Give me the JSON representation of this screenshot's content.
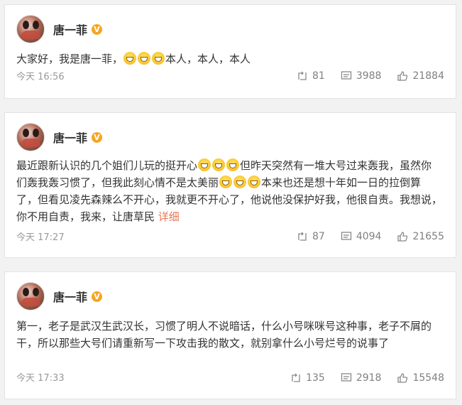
{
  "posts": [
    {
      "author": "唐一菲",
      "verified_mark": "V",
      "text_parts": [
        "大家好，我是唐一菲，",
        "本人，本人，本人"
      ],
      "emoji_icons": [
        "smile-face-icon",
        "laugh-cry-icon",
        "laugh-cry-icon"
      ],
      "time": "今天 16:56",
      "repost_count": "81",
      "comment_count": "3988",
      "like_count": "21884"
    },
    {
      "author": "唐一菲",
      "verified_mark": "V",
      "text_parts": [
        "最近跟新认识的几个姐们儿玩的挺开心",
        "但昨天突然有一堆大号过来轰我，虽然你们轰我轰习惯了，但我此刻心情不是太美丽",
        "本来也还是想十年如一日的拉倒算了，但看见凌先森辣么不开心，我就更不开心了，他说他没保护好我，他很自责。我想说，你不用自责，我来，让唐草民 "
      ],
      "more_label": "详细",
      "emoji_icons": [
        "grin-icon"
      ],
      "time": "今天 17:27",
      "repost_count": "87",
      "comment_count": "4094",
      "like_count": "21655"
    },
    {
      "author": "唐一菲",
      "verified_mark": "V",
      "text_parts": [
        "第一，老子是武汉生武汉长，习惯了明人不说暗话，什么小号咪咪号这种事，老子不屑的干，所以那些大号们请重新写一下攻击我的散文，就别拿什么小号烂号的说事了"
      ],
      "time": "今天 17:33",
      "repost_count": "135",
      "comment_count": "2918",
      "like_count": "15548"
    }
  ],
  "colors": {
    "accent": "#eb7350",
    "verified": "#f5a623",
    "muted": "#999999"
  }
}
